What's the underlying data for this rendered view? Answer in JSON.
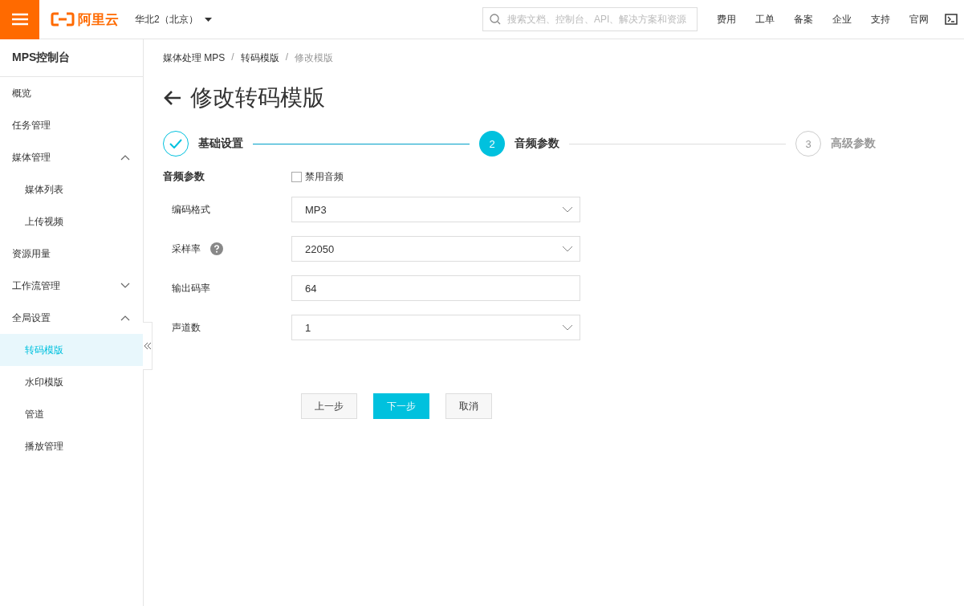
{
  "header": {
    "logo": "阿里云",
    "region": "华北2（北京）",
    "search": {
      "placeholder": "搜索文档、控制台、API、解决方案和资源"
    },
    "links": [
      "费用",
      "工单",
      "备案",
      "企业",
      "支持",
      "官网"
    ]
  },
  "sidebar": {
    "title": "MPS控制台",
    "items": [
      {
        "label": "概览",
        "selected": false
      },
      {
        "label": "任务管理",
        "selected": false
      },
      {
        "label": "媒体管理",
        "selected": false,
        "expanded": true,
        "children": [
          {
            "label": "媒体列表",
            "selected": false
          },
          {
            "label": "上传视频",
            "selected": false
          }
        ]
      },
      {
        "label": "资源用量",
        "selected": false
      },
      {
        "label": "工作流管理",
        "selected": false,
        "expanded": false
      },
      {
        "label": "全局设置",
        "selected": false,
        "expanded": true,
        "children": [
          {
            "label": "转码模版",
            "selected": true
          },
          {
            "label": "水印模版",
            "selected": false
          },
          {
            "label": "管道",
            "selected": false
          },
          {
            "label": "播放管理",
            "selected": false
          }
        ]
      }
    ]
  },
  "breadcrumb": {
    "separator": "/",
    "items": [
      "媒体处理 MPS",
      "转码模版",
      "修改模版"
    ]
  },
  "page_title": "修改转码模版",
  "steps": [
    {
      "label": "基础设置",
      "kind": "done"
    },
    {
      "label": "音频参数",
      "kind": "active",
      "number": "2"
    },
    {
      "label": "高级参数",
      "kind": "pending",
      "number": "3"
    }
  ],
  "section": {
    "title": "音频参数",
    "checkbox": {
      "label": "禁用音频",
      "checked": false
    }
  },
  "fields": [
    {
      "label": "编码格式",
      "kind": "select",
      "value": "MP3",
      "help": false
    },
    {
      "label": "采样率",
      "kind": "select",
      "value": "22050",
      "help": true
    },
    {
      "label": "输出码率",
      "kind": "input",
      "value": "64",
      "help": false
    },
    {
      "label": "声道数",
      "kind": "select",
      "value": "1",
      "help": false
    }
  ],
  "buttons": [
    {
      "label": "上一步",
      "kind": "default"
    },
    {
      "label": "下一步",
      "kind": "primary"
    },
    {
      "label": "取消",
      "kind": "default"
    }
  ]
}
